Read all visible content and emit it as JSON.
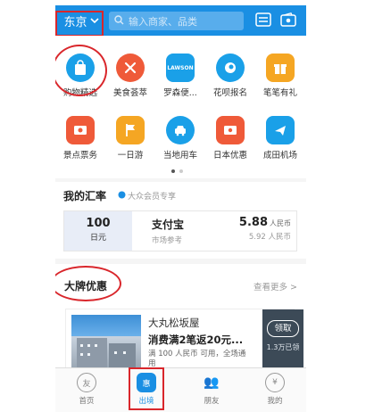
{
  "header": {
    "city": "东京",
    "search_placeholder": "输入商家、品类",
    "icons": [
      "chevron-down-icon",
      "search-icon",
      "scan-icon",
      "wallet-icon"
    ],
    "color": "#1a8fe3"
  },
  "grid": {
    "items": [
      {
        "label": "购物精选",
        "icon": "shopping-bag-icon",
        "color": "#1aa0e8"
      },
      {
        "label": "美食荟萃",
        "icon": "fork-knife-icon",
        "color": "#ef5a39"
      },
      {
        "label": "罗森便...",
        "icon": "lawson-icon",
        "icon_text": "LAWSON",
        "color": "#1aa0e8"
      },
      {
        "label": "花呗报名",
        "icon": "flower-icon",
        "color": "#1aa0e8"
      },
      {
        "label": "笔笔有礼",
        "icon": "gift-icon",
        "color": "#f5a623"
      },
      {
        "label": "景点票务",
        "icon": "ticket-icon",
        "color": "#ef5a39"
      },
      {
        "label": "一日游",
        "icon": "flag-icon",
        "color": "#f5a623"
      },
      {
        "label": "当地用车",
        "icon": "car-icon",
        "color": "#1aa0e8"
      },
      {
        "label": "日本优惠",
        "icon": "coupon-icon",
        "color": "#ef5a39"
      },
      {
        "label": "成田机场",
        "icon": "plane-icon",
        "color": "#1aa0e8"
      }
    ],
    "page_indicator": {
      "current": 1,
      "total": 2
    }
  },
  "exchange": {
    "title": "我的汇率",
    "subtitle": "大众会员专享",
    "amount": "100",
    "currency": "日元",
    "provider": "支付宝",
    "provider_note": "市场参考",
    "rate": "5.88",
    "rate_unit": "人民币",
    "market_rate": "5.92 人民币"
  },
  "deals": {
    "title": "大牌优惠",
    "more": "查看更多 >",
    "item": {
      "name": "大丸松坂屋",
      "promo": "消费满2笔返20元...",
      "note": "满 100 人民币 可用，全场通用",
      "claim_label": "领取",
      "claim_count": "1.3万已领"
    }
  },
  "tabbar": {
    "tabs": [
      {
        "label": "首页",
        "icon": "home-icon",
        "glyph": "友"
      },
      {
        "label": "出境",
        "icon": "travel-icon",
        "glyph": "惠"
      },
      {
        "label": "朋友",
        "icon": "friends-icon",
        "glyph": "👥"
      },
      {
        "label": "我的",
        "icon": "profile-icon",
        "glyph": "¥"
      }
    ],
    "active": 1,
    "active_color": "#1a8fe3"
  }
}
